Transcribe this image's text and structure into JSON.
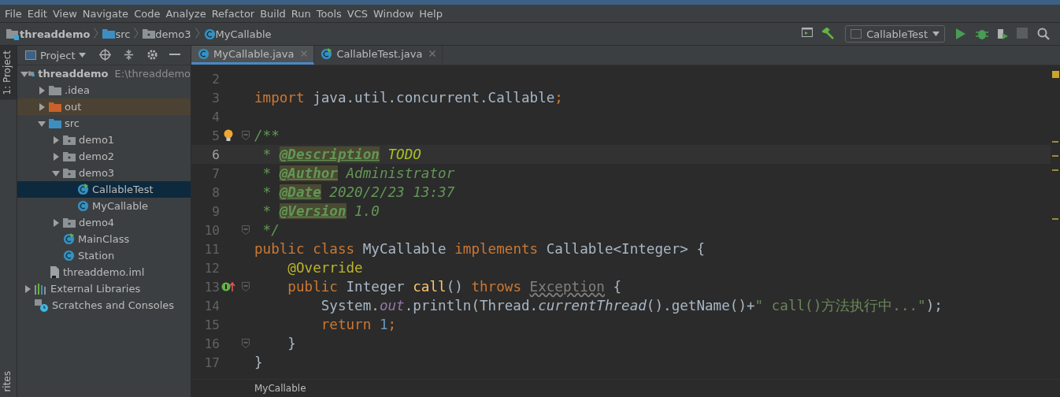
{
  "menu": [
    "File",
    "Edit",
    "View",
    "Navigate",
    "Code",
    "Analyze",
    "Refactor",
    "Build",
    "Run",
    "Tools",
    "VCS",
    "Window",
    "Help"
  ],
  "breadcrumbs": [
    {
      "label": "threaddemo",
      "kind": "module"
    },
    {
      "label": "src",
      "kind": "source-folder"
    },
    {
      "label": "demo3",
      "kind": "package"
    },
    {
      "label": "MyCallable",
      "kind": "class"
    }
  ],
  "run_config": {
    "label": "CallableTest"
  },
  "side_tabs": [
    {
      "label": "1: Project",
      "selected": true
    },
    {
      "label": "rites",
      "selected": false
    }
  ],
  "project_panel": {
    "title": "Project"
  },
  "tree": [
    {
      "label": "threaddemo",
      "path": "E:\\threaddemo",
      "kind": "module",
      "expanded": true,
      "selected": false,
      "children": [
        {
          "label": ".idea",
          "kind": "folder",
          "expanded": false,
          "selected": false
        },
        {
          "label": "out",
          "kind": "excluded-folder",
          "expanded": false,
          "selected": false
        },
        {
          "label": "src",
          "kind": "source-folder",
          "expanded": true,
          "selected": false,
          "children": [
            {
              "label": "demo1",
              "kind": "package",
              "expanded": false,
              "selected": false
            },
            {
              "label": "demo2",
              "kind": "package",
              "expanded": false,
              "selected": false
            },
            {
              "label": "demo3",
              "kind": "package",
              "expanded": true,
              "selected": false,
              "children": [
                {
                  "label": "CallableTest",
                  "kind": "runnable-class",
                  "selected": true
                },
                {
                  "label": "MyCallable",
                  "kind": "class",
                  "selected": false
                }
              ]
            },
            {
              "label": "demo4",
              "kind": "package",
              "expanded": false,
              "selected": false
            },
            {
              "label": "MainClass",
              "kind": "runnable-class",
              "selected": false
            },
            {
              "label": "Station",
              "kind": "class",
              "selected": false
            }
          ]
        },
        {
          "label": "threaddemo.iml",
          "kind": "iml",
          "selected": false
        }
      ]
    },
    {
      "label": "External Libraries",
      "kind": "libraries",
      "expanded": false,
      "selected": false
    },
    {
      "label": "Scratches and Consoles",
      "kind": "scratches",
      "selected": false
    }
  ],
  "tabs": [
    {
      "label": "MyCallable.java",
      "kind": "class",
      "selected": true
    },
    {
      "label": "CallableTest.java",
      "kind": "runnable-class",
      "selected": false
    }
  ],
  "code": [
    {
      "number": "2",
      "current": false,
      "fold": false,
      "kind": "plain"
    },
    {
      "number": "3",
      "current": false,
      "fold": false,
      "kind": "plain",
      "tokens": [
        {
          "kind": "keyword",
          "text": "import "
        },
        {
          "kind": "plain",
          "text": "java.util.concurrent.Callable"
        },
        {
          "kind": "keyword",
          "text": ";"
        }
      ]
    },
    {
      "number": "4",
      "current": false,
      "fold": false,
      "kind": "plain"
    },
    {
      "number": "5",
      "current": false,
      "fold": true,
      "kind": "bulb",
      "tokens": [
        {
          "kind": "comment",
          "text": "/**"
        }
      ]
    },
    {
      "number": "6",
      "current": true,
      "fold": false,
      "kind": "plain",
      "tokens": [
        {
          "kind": "comment",
          "text": " * "
        },
        {
          "kind": "tag",
          "text": "@Description"
        },
        {
          "kind": "todo",
          "text": " TODO"
        }
      ]
    },
    {
      "number": "7",
      "current": false,
      "fold": false,
      "kind": "plain",
      "tokens": [
        {
          "kind": "comment",
          "text": " * "
        },
        {
          "kind": "tag",
          "text": "@Author"
        },
        {
          "kind": "comment",
          "text": " Administrator"
        }
      ]
    },
    {
      "number": "8",
      "current": false,
      "fold": false,
      "kind": "plain",
      "tokens": [
        {
          "kind": "comment",
          "text": " * "
        },
        {
          "kind": "tag",
          "text": "@Date"
        },
        {
          "kind": "comment",
          "text": " 2020/2/23 13:37"
        }
      ]
    },
    {
      "number": "9",
      "current": false,
      "fold": false,
      "kind": "plain",
      "tokens": [
        {
          "kind": "comment",
          "text": " * "
        },
        {
          "kind": "tag",
          "text": "@Version"
        },
        {
          "kind": "comment",
          "text": " 1.0"
        }
      ]
    },
    {
      "number": "10",
      "current": false,
      "fold": true,
      "kind": "plain",
      "tokens": [
        {
          "kind": "comment",
          "text": " */"
        }
      ]
    },
    {
      "number": "11",
      "current": false,
      "fold": false,
      "kind": "plain",
      "tokens": [
        {
          "kind": "keyword",
          "text": "public class "
        },
        {
          "kind": "plain",
          "text": "MyCallable "
        },
        {
          "kind": "keyword",
          "text": "implements "
        },
        {
          "kind": "plain",
          "text": "Callable<Integer> {"
        }
      ]
    },
    {
      "number": "12",
      "current": false,
      "fold": false,
      "kind": "plain",
      "tokens": [
        {
          "kind": "annotation",
          "text": "    @Override"
        }
      ]
    },
    {
      "number": "13",
      "current": false,
      "fold": true,
      "kind": "implements",
      "tokens": [
        {
          "kind": "keyword",
          "text": "    public "
        },
        {
          "kind": "plain",
          "text": "Integer "
        },
        {
          "kind": "method",
          "text": "call"
        },
        {
          "kind": "plain",
          "text": "() "
        },
        {
          "kind": "keyword",
          "text": "throws "
        },
        {
          "kind": "unused",
          "text": "Exception"
        },
        {
          "kind": "plain",
          "text": " {"
        }
      ]
    },
    {
      "number": "14",
      "current": false,
      "fold": false,
      "kind": "plain",
      "tokens": [
        {
          "kind": "plain",
          "text": "        System."
        },
        {
          "kind": "field",
          "text": "out"
        },
        {
          "kind": "plain",
          "text": ".println(Thread."
        },
        {
          "kind": "italic",
          "text": "currentThread"
        },
        {
          "kind": "plain",
          "text": "().getName()+"
        },
        {
          "kind": "string",
          "text": "\" call()方法执行中...\""
        },
        {
          "kind": "plain",
          "text": ");"
        }
      ]
    },
    {
      "number": "15",
      "current": false,
      "fold": false,
      "kind": "plain",
      "tokens": [
        {
          "kind": "keyword",
          "text": "        return "
        },
        {
          "kind": "number",
          "text": "1"
        },
        {
          "kind": "keyword",
          "text": ";"
        }
      ]
    },
    {
      "number": "16",
      "current": false,
      "fold": true,
      "kind": "plain",
      "tokens": [
        {
          "kind": "plain",
          "text": "    }"
        }
      ]
    },
    {
      "number": "17",
      "current": false,
      "fold": false,
      "kind": "plain",
      "tokens": [
        {
          "kind": "plain",
          "text": "}"
        }
      ]
    }
  ],
  "editor_breadcrumb": "MyCallable"
}
